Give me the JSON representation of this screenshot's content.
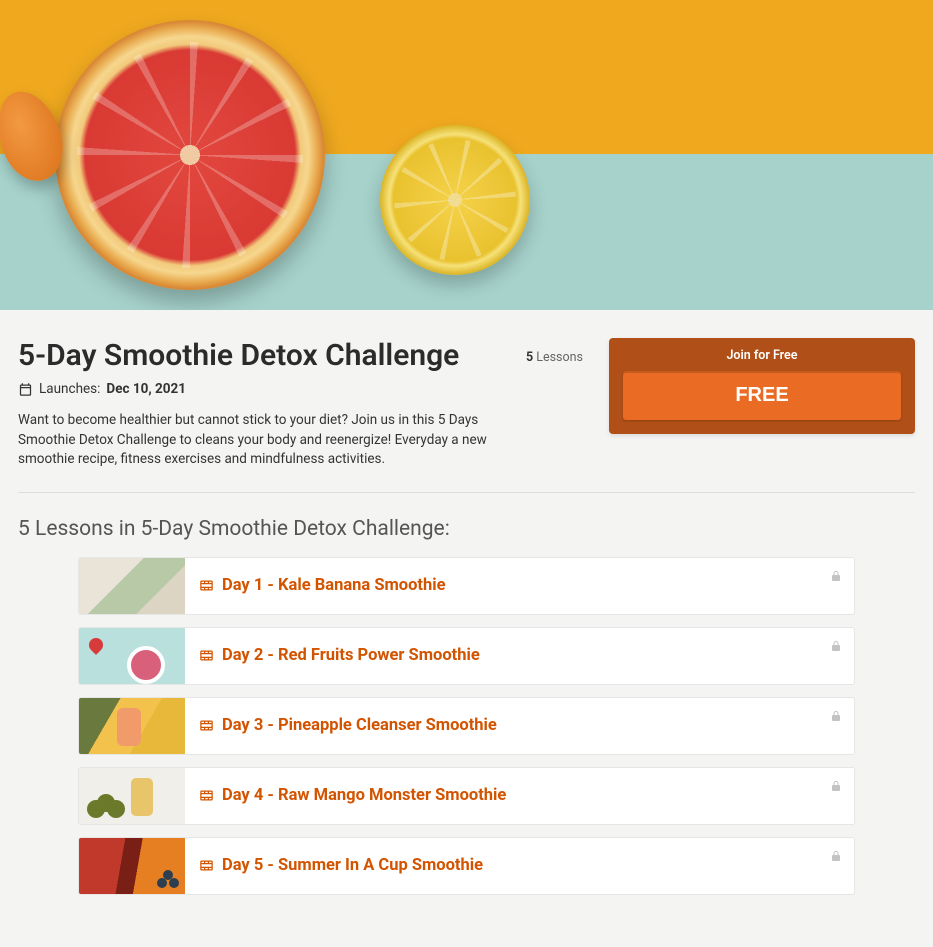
{
  "course": {
    "title": "5-Day Smoothie Detox Challenge",
    "launch_label": "Launches:",
    "launch_date": "Dec 10, 2021",
    "lesson_count": "5",
    "lesson_count_label": "Lessons",
    "description": "Want to become healthier but cannot stick to your diet? Join us in this 5 Days Smoothie Detox Challenge to cleans your body and reenergize! Everyday a new smoothie recipe, fitness exercises and mindfulness activities."
  },
  "cta": {
    "heading": "Join for Free",
    "button": "FREE"
  },
  "lessons_section": {
    "heading": "5 Lessons in 5-Day Smoothie Detox Challenge:"
  },
  "lessons": [
    {
      "title": "Day 1 - Kale Banana Smoothie"
    },
    {
      "title": "Day 2 - Red Fruits Power Smoothie"
    },
    {
      "title": "Day 3 - Pineapple Cleanser Smoothie"
    },
    {
      "title": "Day 4 - Raw Mango Monster Smoothie"
    },
    {
      "title": "Day 5 - Summer In A Cup Smoothie"
    }
  ]
}
